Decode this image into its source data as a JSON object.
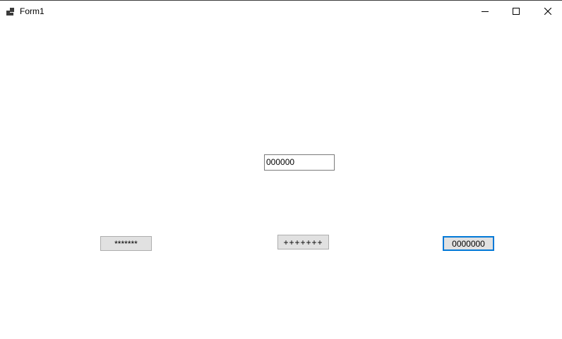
{
  "window": {
    "title": "Form1",
    "icon": "form-app-icon",
    "controls": {
      "minimize_icon": "minimize-icon",
      "maximize_icon": "maximize-icon",
      "close_icon": "close-icon"
    }
  },
  "form": {
    "textbox_value": "000000",
    "buttons": {
      "stars_label": "*******",
      "plus_label": "+++++++",
      "zeros_label": "0000000"
    }
  },
  "colors": {
    "focus_border": "#0078d7",
    "button_face": "#e1e1e1"
  }
}
